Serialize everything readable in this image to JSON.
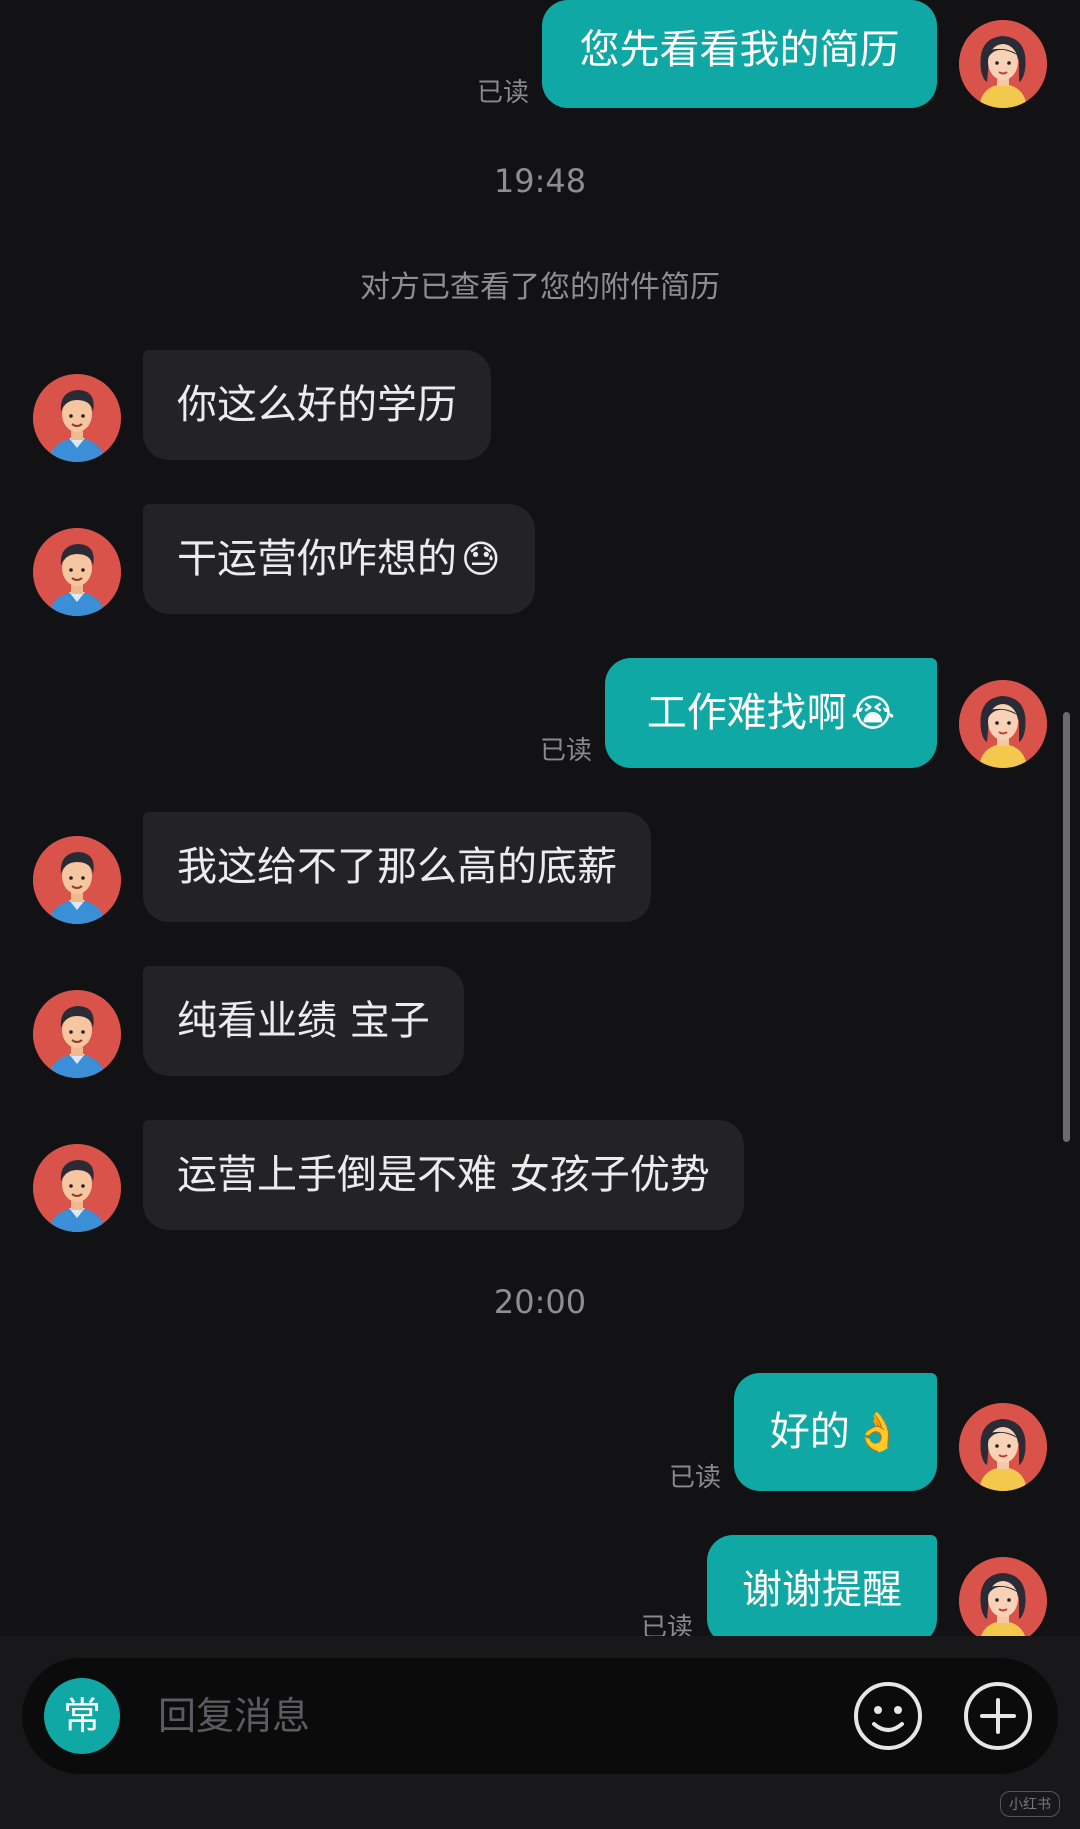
{
  "messages": [
    {
      "side": "out",
      "text": "您先看看我的简历",
      "read": "已读"
    },
    {
      "type": "time",
      "text": "19:48"
    },
    {
      "type": "system",
      "text": "对方已查看了您的附件简历"
    },
    {
      "side": "in",
      "text": "你这么好的学历"
    },
    {
      "side": "in",
      "text": "干运营你咋想的",
      "emoji": "😓"
    },
    {
      "side": "out",
      "text": "工作难找啊",
      "emoji": "😭",
      "read": "已读"
    },
    {
      "side": "in",
      "text": "我这给不了那么高的底薪"
    },
    {
      "side": "in",
      "text": "纯看业绩 宝子"
    },
    {
      "side": "in",
      "text": "运营上手倒是不难 女孩子优势"
    },
    {
      "type": "time",
      "text": "20:00"
    },
    {
      "side": "out",
      "text": "好的",
      "emoji": "👌",
      "read": "已读"
    },
    {
      "side": "out",
      "text": "谢谢提醒",
      "read": "已读"
    }
  ],
  "input": {
    "common_phrases_label": "常",
    "placeholder": "回复消息",
    "emoji_icon": "smiley-face-icon",
    "more_icon": "plus-circle-icon"
  },
  "colors": {
    "background": "#121214",
    "outgoing_bubble": "#10a8a4",
    "incoming_bubble": "#232326",
    "avatar_bg": "#d9534b"
  },
  "watermark": "小红书"
}
